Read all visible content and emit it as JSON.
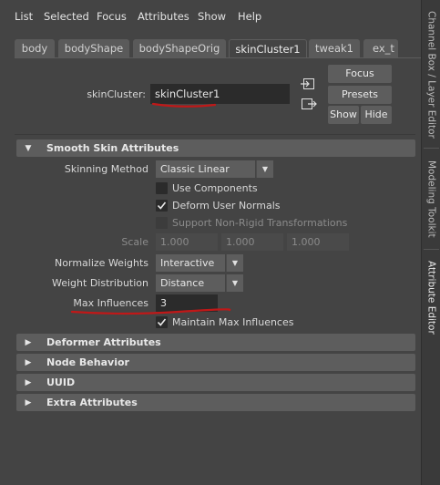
{
  "menu": [
    "List",
    "Selected",
    "Focus",
    "Attributes",
    "Show",
    "Help"
  ],
  "tabs": [
    "body",
    "bodyShape",
    "bodyShapeOrig",
    "skinCluster1",
    "tweak1",
    "ex_t"
  ],
  "active_tab_index": 3,
  "node": {
    "label": "skinCluster:",
    "value": "skinCluster1"
  },
  "buttons": {
    "focus": "Focus",
    "presets": "Presets",
    "show": "Show",
    "hide": "Hide"
  },
  "dock_tabs": [
    "Channel Box / Layer Editor",
    "Modeling Toolkit",
    "Attribute Editor"
  ],
  "smooth_skin": {
    "title": "Smooth Skin Attributes",
    "skinning_method_label": "Skinning Method",
    "skinning_method_value": "Classic Linear",
    "use_components": "Use Components",
    "use_components_checked": false,
    "deform_user_normals": "Deform User Normals",
    "deform_user_normals_checked": true,
    "support_nonrigid": "Support Non-Rigid Transformations",
    "support_nonrigid_checked": false,
    "scale_label": "Scale",
    "scale_values": [
      "1.000",
      "1.000",
      "1.000"
    ],
    "normalize_weights_label": "Normalize Weights",
    "normalize_weights_value": "Interactive",
    "weight_distribution_label": "Weight Distribution",
    "weight_distribution_value": "Distance",
    "max_influences_label": "Max Influences",
    "max_influences_value": "3",
    "maintain_max_influences": "Maintain Max Influences",
    "maintain_max_influences_checked": true
  },
  "sections": [
    "Deformer Attributes",
    "Node Behavior",
    "UUID",
    "Extra Attributes"
  ],
  "colors": {
    "background": "#444444",
    "field": "#2b2b2b",
    "section": "#5d5d5d",
    "annotation_red": "#c01818"
  }
}
